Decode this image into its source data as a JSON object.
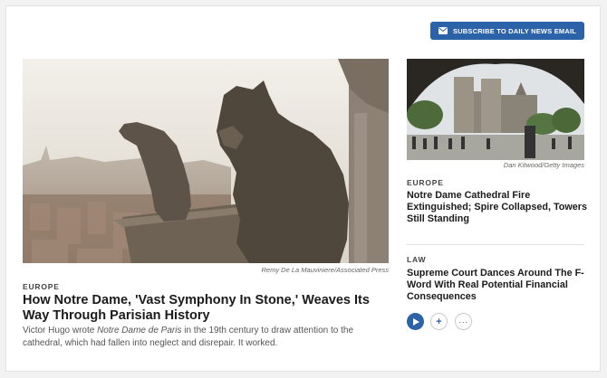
{
  "subscribe": {
    "label": "SUBSCRIBE TO DAILY NEWS EMAIL",
    "icon": "envelope-icon",
    "color": "#2c62a8"
  },
  "feature": {
    "image_credit": "Remy De La Mauviniere/Associated Press",
    "section": "EUROPE",
    "headline": "How Notre Dame, 'Vast Symphony In Stone,' Weaves Its Way Through Parisian History",
    "dek_before": "Victor Hugo wrote ",
    "dek_italic": "Notre Dame de Paris",
    "dek_after": " in the 19th century to draw attention to the cathedral, which had fallen into neglect and disrepair. It worked."
  },
  "side_story": {
    "image_credit": "Dan Kitwood/Getty Images",
    "section": "EUROPE",
    "headline": "Notre Dame Cathedral Fire Extinguished; Spire Collapsed, Towers Still Standing"
  },
  "law_story": {
    "section": "LAW",
    "headline": "Supreme Court Dances Around The F-Word With Real Potential Financial Consequences"
  },
  "actions": {
    "play_icon": "play-icon",
    "add_label": "+",
    "more_label": "···",
    "accent": "#2c62a8"
  }
}
